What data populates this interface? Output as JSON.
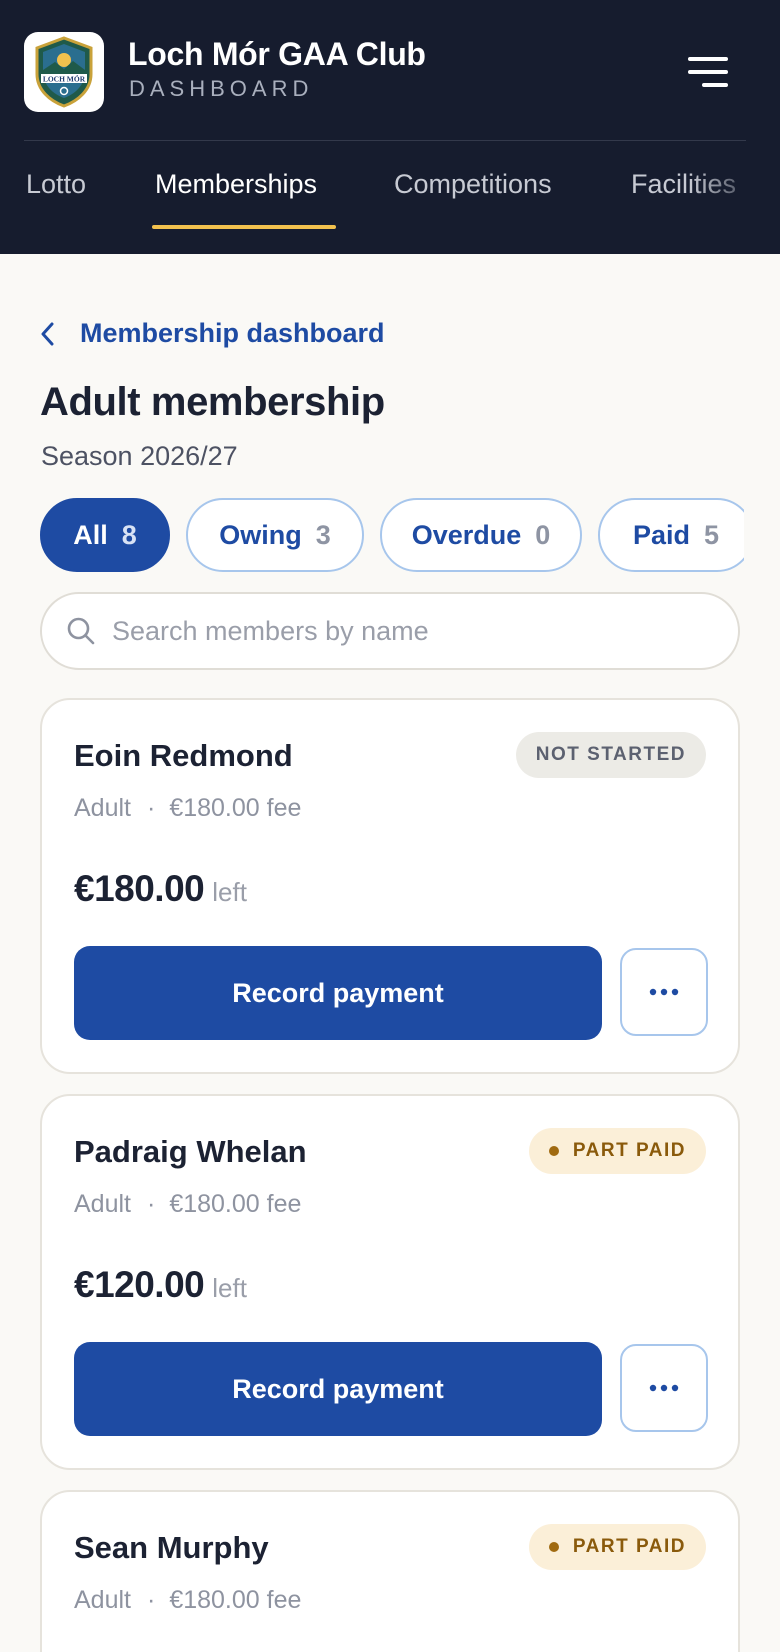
{
  "header": {
    "club_name": "Loch Mór GAA Club",
    "subtitle": "DASHBOARD",
    "logo_text": "LOCH MÓR",
    "logo_icon": "club-crest-icon",
    "menu_icon": "hamburger-menu-icon"
  },
  "nav": {
    "tabs": [
      {
        "label": "Lotto",
        "active": false
      },
      {
        "label": "Memberships",
        "active": true
      },
      {
        "label": "Competitions",
        "active": false
      },
      {
        "label": "Facilities",
        "active": false
      }
    ]
  },
  "page": {
    "back_label": "Membership dashboard",
    "back_icon": "chevron-left-icon",
    "title": "Adult membership",
    "season": "Season 2026/27"
  },
  "filters": [
    {
      "label": "All",
      "count": "8",
      "active": true
    },
    {
      "label": "Owing",
      "count": "3",
      "active": false
    },
    {
      "label": "Overdue",
      "count": "0",
      "active": false
    },
    {
      "label": "Paid",
      "count": "5",
      "active": false
    }
  ],
  "search": {
    "placeholder": "Search members by name",
    "value": "",
    "icon": "search-icon"
  },
  "members": [
    {
      "name": "Eoin Redmond",
      "status": "NOT STARTED",
      "category": "Adult",
      "separator": "·",
      "fee": "€180.00 fee",
      "remaining": "€180.00",
      "remaining_suffix": "left",
      "action_label": "Record payment",
      "more_icon": "more-horizontal-icon"
    },
    {
      "name": "Padraig Whelan",
      "status": "PART PAID",
      "category": "Adult",
      "separator": "·",
      "fee": "€180.00 fee",
      "remaining": "€120.00",
      "remaining_suffix": "left",
      "action_label": "Record payment",
      "more_icon": "more-horizontal-icon"
    },
    {
      "name": "Sean Murphy",
      "status": "PART PAID",
      "category": "Adult",
      "separator": "·",
      "fee": "€180.00 fee"
    }
  ],
  "colors": {
    "header_bg": "#161c2e",
    "accent_blue": "#1e4ba3",
    "tab_underline": "#f2c14e",
    "part_paid_bg": "#fbefd8",
    "part_paid_text": "#8a5a0b",
    "not_started_bg": "#ecebe6",
    "page_bg": "#faf9f6"
  }
}
